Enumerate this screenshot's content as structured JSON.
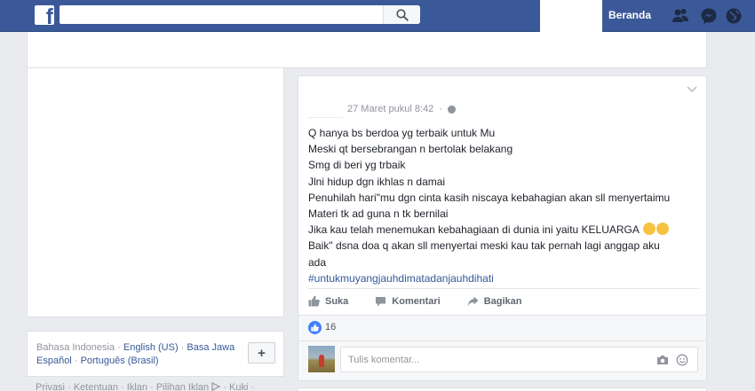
{
  "topbar": {
    "logo_letter": "f",
    "search_placeholder": "",
    "home_label": "Beranda"
  },
  "language": {
    "current": "Bahasa Indonesia",
    "options": [
      "English (US)",
      "Basa Jawa",
      "Español",
      "Português (Brasil)"
    ],
    "add_label": "+"
  },
  "footer": {
    "links": [
      "Privasi",
      "Ketentuan",
      "Iklan",
      "Pilihan Iklan",
      "Kuki"
    ],
    "separator": "·"
  },
  "post": {
    "timestamp": "27 Maret pukul 8:42",
    "timestamp_sep": "·",
    "lines": [
      "Q hanya bs berdoa yg terbaik untuk Mu",
      "Meski qt bersebrangan n bertolak belakang",
      "Smg di beri yg trbaik",
      "Jlni hidup dgn ikhlas n damai",
      "Penuhilah hari\"mu dgn cinta kasih niscaya kebahagian akan sll menyertaimu",
      "Materi tk ad guna n tk bernilai",
      "Jika kau telah menemukan kebahagiaan di dunia ini yaitu KELUARGA",
      "Baik\" dsna doa q akan sll menyertai meski kau tak pernah lagi anggap aku",
      "ada"
    ],
    "hashtag": "#untukmuyangjauhdimatadanjauhdihati",
    "actions": {
      "like": "Suka",
      "comment": "Komentari",
      "share": "Bagikan"
    },
    "reaction_count": "16"
  },
  "comment": {
    "placeholder": "Tulis komentar..."
  },
  "colors": {
    "brand": "#3b5998",
    "link": "#365899",
    "like_blue": "#4080ff"
  }
}
